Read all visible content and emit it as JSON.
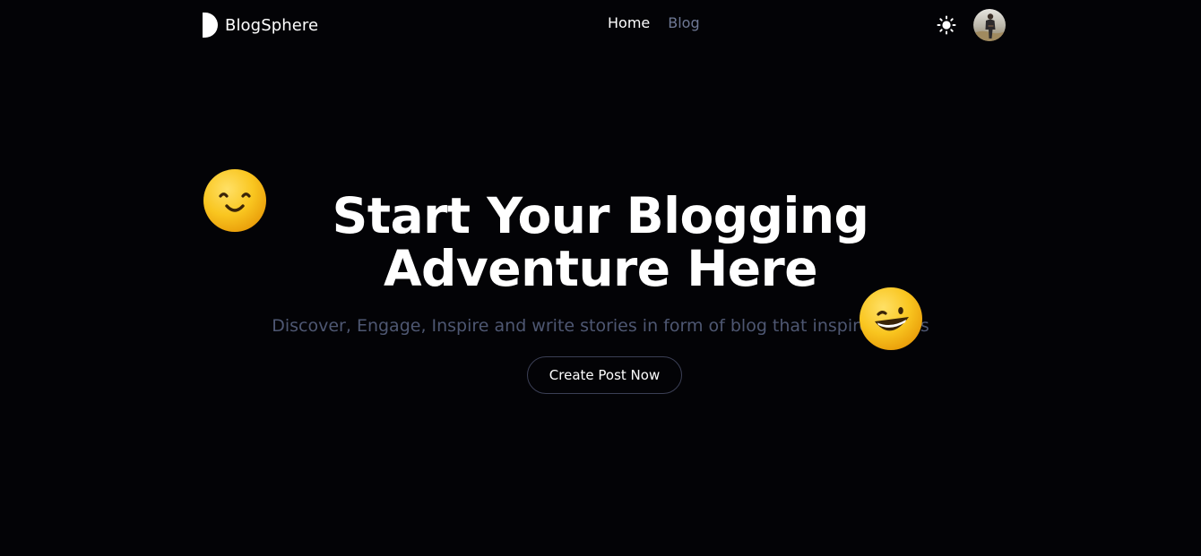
{
  "navbar": {
    "brand_name": "BlogSphere",
    "links": [
      {
        "label": "Home",
        "active": true
      },
      {
        "label": "Blog",
        "active": false
      }
    ],
    "theme_icon": "sun-icon",
    "avatar_icon": "user-avatar"
  },
  "hero": {
    "title_line1": "Start Your Blogging",
    "title_line2": "Adventure Here",
    "subtitle": "Discover, Engage, Inspire and write stories in form of blog that inspire others",
    "cta_label": "Create Post Now"
  },
  "decorations": {
    "left_emoji": "smiling-face-icon",
    "right_emoji": "grinning-face-icon"
  },
  "colors": {
    "background": "#030306",
    "text_primary": "#ffffff",
    "text_muted": "#6e7894",
    "subtitle": "#4e5772",
    "emoji_yellow": "#f7c21f"
  }
}
